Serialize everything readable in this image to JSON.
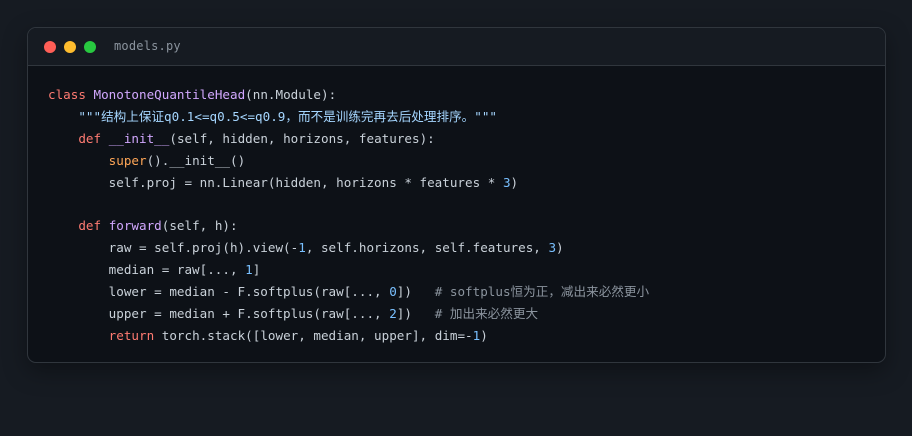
{
  "window": {
    "filename": "models.py",
    "traffic_lights": {
      "close_color": "#ff5f57",
      "minimize_color": "#febc2e",
      "maximize_color": "#28c840"
    }
  },
  "theme": {
    "keyword": "#ff7b72",
    "class_name": "#d2a8ff",
    "string": "#a5d6ff",
    "number": "#79c0ff",
    "builtin": "#ffa657",
    "comment": "#8b949e",
    "text": "#c9d1d9"
  },
  "code": {
    "lines": [
      [
        {
          "t": "class",
          "k": "kw"
        },
        {
          "t": " ",
          "k": "plain"
        },
        {
          "t": "MonotoneQuantileHead",
          "k": "cls"
        },
        {
          "t": "(nn.Module):",
          "k": "plain"
        }
      ],
      [
        {
          "t": "    \"\"\"结构上保证q0.1<=q0.5<=q0.9，而不是训练完再去后处理排序。\"\"\"",
          "k": "str"
        }
      ],
      [
        {
          "t": "    ",
          "k": "plain"
        },
        {
          "t": "def",
          "k": "kw"
        },
        {
          "t": " ",
          "k": "plain"
        },
        {
          "t": "__init__",
          "k": "fn"
        },
        {
          "t": "(self, hidden, horizons, features):",
          "k": "plain"
        }
      ],
      [
        {
          "t": "        ",
          "k": "plain"
        },
        {
          "t": "super",
          "k": "builtin"
        },
        {
          "t": "().__init__()",
          "k": "plain"
        }
      ],
      [
        {
          "t": "        self.proj = nn.Linear(hidden, horizons * features * ",
          "k": "plain"
        },
        {
          "t": "3",
          "k": "num"
        },
        {
          "t": ")",
          "k": "plain"
        }
      ],
      [
        {
          "t": "",
          "k": "plain"
        }
      ],
      [
        {
          "t": "    ",
          "k": "plain"
        },
        {
          "t": "def",
          "k": "kw"
        },
        {
          "t": " ",
          "k": "plain"
        },
        {
          "t": "forward",
          "k": "fn"
        },
        {
          "t": "(self, h):",
          "k": "plain"
        }
      ],
      [
        {
          "t": "        raw = self.proj(h).view(-",
          "k": "plain"
        },
        {
          "t": "1",
          "k": "num"
        },
        {
          "t": ", self.horizons, self.features, ",
          "k": "plain"
        },
        {
          "t": "3",
          "k": "num"
        },
        {
          "t": ")",
          "k": "plain"
        }
      ],
      [
        {
          "t": "        median = raw[..., ",
          "k": "plain"
        },
        {
          "t": "1",
          "k": "num"
        },
        {
          "t": "]",
          "k": "plain"
        }
      ],
      [
        {
          "t": "        lower = median - F.softplus(raw[..., ",
          "k": "plain"
        },
        {
          "t": "0",
          "k": "num"
        },
        {
          "t": "])   ",
          "k": "plain"
        },
        {
          "t": "# softplus恒为正，减出来必然更小",
          "k": "com"
        }
      ],
      [
        {
          "t": "        upper = median + F.softplus(raw[..., ",
          "k": "plain"
        },
        {
          "t": "2",
          "k": "num"
        },
        {
          "t": "])   ",
          "k": "plain"
        },
        {
          "t": "# 加出来必然更大",
          "k": "com"
        }
      ],
      [
        {
          "t": "        ",
          "k": "plain"
        },
        {
          "t": "return",
          "k": "kw"
        },
        {
          "t": " torch.stack([lower, median, upper], dim=-",
          "k": "plain"
        },
        {
          "t": "1",
          "k": "num"
        },
        {
          "t": ")",
          "k": "plain"
        }
      ]
    ]
  }
}
